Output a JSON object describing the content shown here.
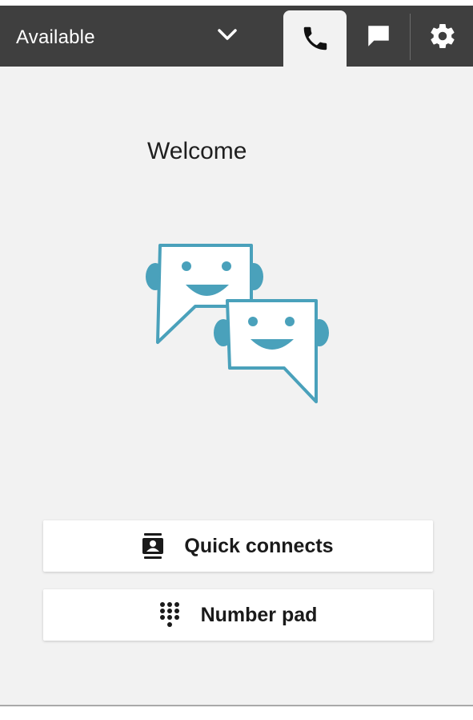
{
  "status": {
    "label": "Available",
    "options_icon": "chevron-down-icon"
  },
  "tabs": [
    {
      "name": "phone",
      "icon": "phone-icon",
      "active": true
    },
    {
      "name": "chat",
      "icon": "chat-icon",
      "active": false
    },
    {
      "name": "settings",
      "icon": "gear-icon",
      "active": false
    }
  ],
  "main": {
    "welcome": "Welcome",
    "illustration_icon": "chat-bots-illustration"
  },
  "actions": {
    "quick_connects": {
      "label": "Quick connects",
      "icon": "contact-card-icon"
    },
    "number_pad": {
      "label": "Number pad",
      "icon": "keypad-icon"
    }
  },
  "colors": {
    "topbar": "#3f3f3f",
    "background": "#f2f2f2",
    "accent": "#4aa1bb"
  }
}
